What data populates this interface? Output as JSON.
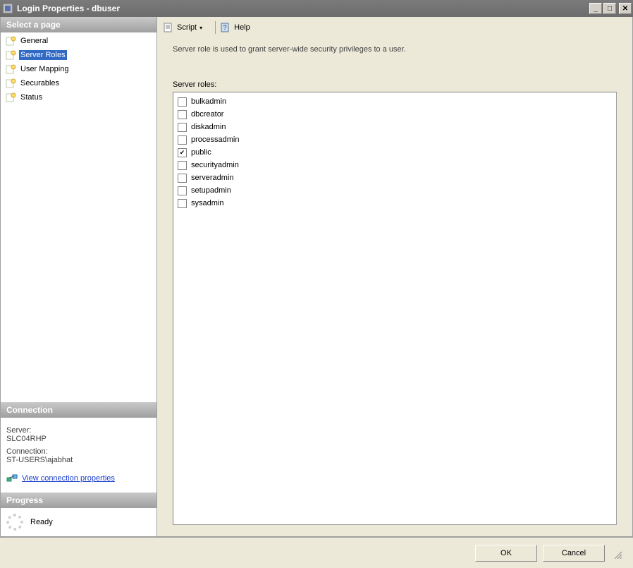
{
  "window": {
    "title": "Login Properties - dbuser"
  },
  "sidebar": {
    "header": "Select a page",
    "pages": [
      {
        "label": "General",
        "selected": false
      },
      {
        "label": "Server Roles",
        "selected": true
      },
      {
        "label": "User Mapping",
        "selected": false
      },
      {
        "label": "Securables",
        "selected": false
      },
      {
        "label": "Status",
        "selected": false
      }
    ]
  },
  "connection": {
    "header": "Connection",
    "server_label": "Server:",
    "server_value": "SLC04RHP",
    "conn_label": "Connection:",
    "conn_value": "ST-USERS\\ajabhat",
    "link_label": "View connection properties"
  },
  "progress": {
    "header": "Progress",
    "status": "Ready"
  },
  "toolbar": {
    "script_label": "Script",
    "help_label": "Help"
  },
  "main": {
    "description": "Server role is used to grant server-wide security privileges to a user.",
    "roles_label": "Server roles:",
    "roles": [
      {
        "name": "bulkadmin",
        "checked": false
      },
      {
        "name": "dbcreator",
        "checked": false
      },
      {
        "name": "diskadmin",
        "checked": false
      },
      {
        "name": "processadmin",
        "checked": false
      },
      {
        "name": "public",
        "checked": true
      },
      {
        "name": "securityadmin",
        "checked": false
      },
      {
        "name": "serveradmin",
        "checked": false
      },
      {
        "name": "setupadmin",
        "checked": false
      },
      {
        "name": "sysadmin",
        "checked": false
      }
    ]
  },
  "buttons": {
    "ok": "OK",
    "cancel": "Cancel"
  }
}
